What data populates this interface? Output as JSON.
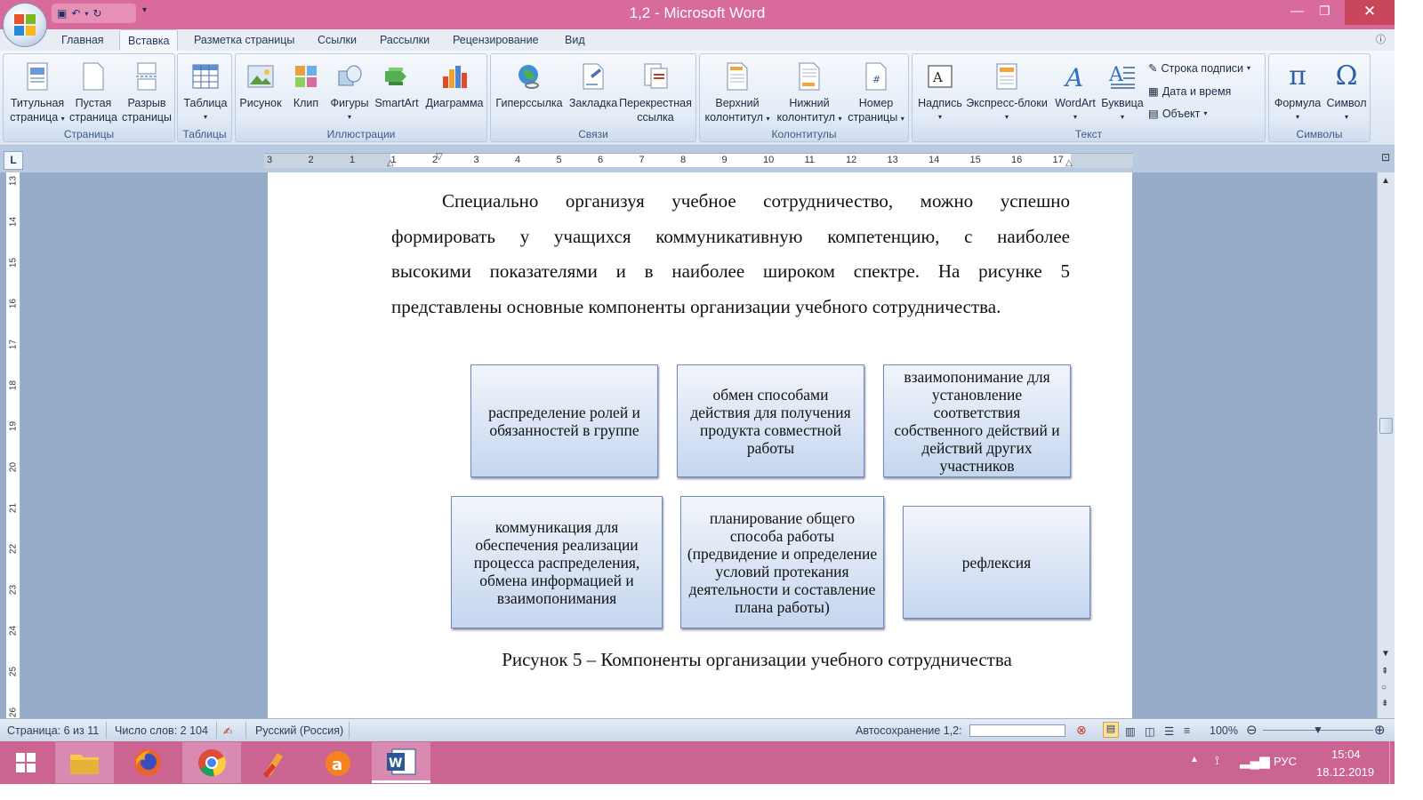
{
  "window": {
    "title": "1,2 - Microsoft Word"
  },
  "tabs": [
    "Главная",
    "Вставка",
    "Разметка страницы",
    "Ссылки",
    "Рассылки",
    "Рецензирование",
    "Вид"
  ],
  "ribbon": {
    "pages": {
      "label": "Страницы",
      "cover_l1": "Титульная",
      "cover_l2": "страница",
      "blank_l1": "Пустая",
      "blank_l2": "страница",
      "break_l1": "Разрыв",
      "break_l2": "страницы"
    },
    "tables": {
      "label": "Таблицы",
      "table": "Таблица"
    },
    "illustrations": {
      "label": "Иллюстрации",
      "picture": "Рисунок",
      "clip": "Клип",
      "shapes": "Фигуры",
      "smartart": "SmartArt",
      "chart": "Диаграмма"
    },
    "links": {
      "label": "Связи",
      "hyperlink": "Гиперссылка",
      "bookmark": "Закладка",
      "xref_l1": "Перекрестная",
      "xref_l2": "ссылка"
    },
    "headerfooter": {
      "label": "Колонтитулы",
      "header_l1": "Верхний",
      "header_l2": "колонтитул",
      "footer_l1": "Нижний",
      "footer_l2": "колонтитул",
      "pagenum_l1": "Номер",
      "pagenum_l2": "страницы"
    },
    "text": {
      "label": "Текст",
      "textbox": "Надпись",
      "quickparts": "Экспресс-блоки",
      "wordart": "WordArt",
      "dropcap": "Буквица",
      "sigline": "Строка подписи",
      "datetime": "Дата и время",
      "object": "Объект"
    },
    "symbols": {
      "label": "Символы",
      "equation": "Формула",
      "symbol": "Символ"
    }
  },
  "document": {
    "paragraph_lines": [
      "Специально организуя учебное сотрудничество, можно успешно",
      "формировать у учащихся коммуникативную компетенцию, с наиболее",
      "высокими показателями и в наиболее широком спектре. На рисунке 5",
      "представлены основные компоненты организации учебного сотрудничества."
    ],
    "boxes": [
      "распределение ролей и обязанностей в группе",
      "обмен способами действия для получения продукта совместной работы",
      "взаимопонимание для установление соответствия собственного действий и действий других участников",
      "коммуникация для обеспечения реализации процесса распределения, обмена информацией и взаимопонимания",
      "планирование общего способа работы (предвидение и определение условий протекания деятельности и составление плана работы)",
      "рефлексия"
    ],
    "caption": "Рисунок 5 – Компоненты организации учебного сотрудничества"
  },
  "ruler": {
    "h_ticks": [
      "3",
      "2",
      "1",
      "1",
      "2",
      "3",
      "4",
      "5",
      "6",
      "7",
      "8",
      "9",
      "10",
      "11",
      "12",
      "13",
      "14",
      "15",
      "16",
      "17"
    ],
    "v_ticks": [
      "13",
      "14",
      "15",
      "16",
      "17",
      "18",
      "19",
      "20",
      "21",
      "22",
      "23",
      "24",
      "25",
      "26"
    ]
  },
  "status": {
    "page": "Страница: 6 из 11",
    "words": "Число слов: 2 104",
    "language": "Русский (Россия)",
    "autosave": "Автосохранение 1,2:",
    "zoom": "100%"
  },
  "tray": {
    "lang": "РУС",
    "time": "15:04",
    "date": "18.12.2019"
  },
  "colors": {
    "titlebar": "#d96a9c",
    "taskbar": "#cc6492",
    "box_border": "#6e8ac0"
  }
}
